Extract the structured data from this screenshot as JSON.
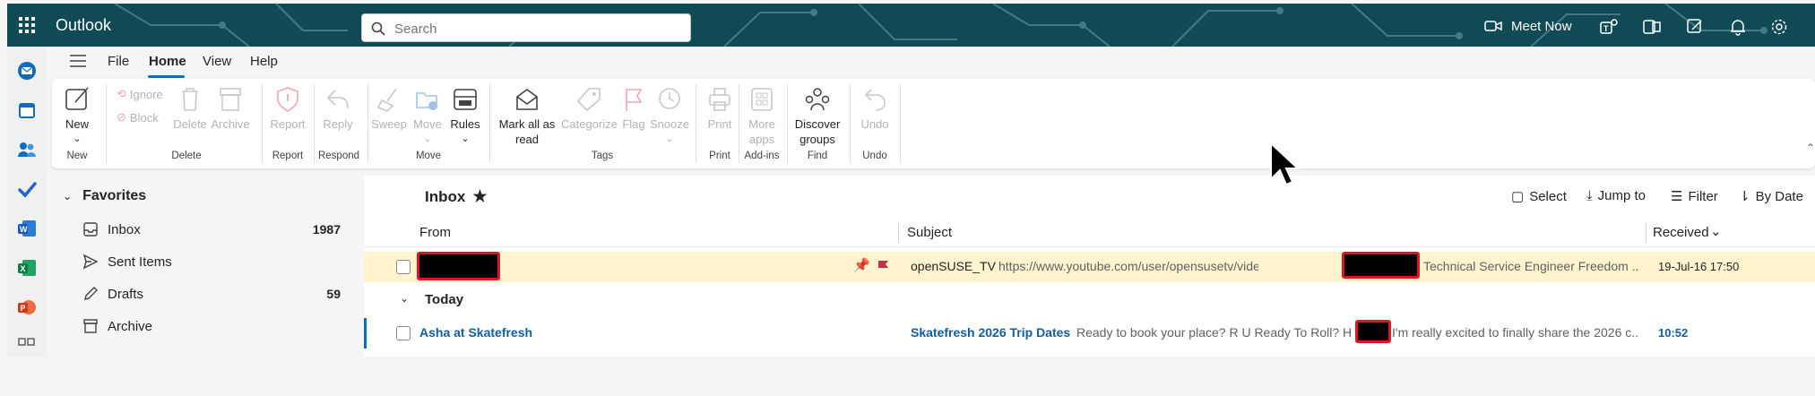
{
  "colors": {
    "brand": "#0f6cbd",
    "header_bg": "#0f4a55",
    "flag": "#c4314b",
    "highlight_row": "#fff4ce",
    "redaction_border": "#e81123"
  },
  "header": {
    "app_name": "Outlook",
    "search_placeholder": "Search",
    "meet_now_label": "Meet Now",
    "icons": [
      "waffle-icon",
      "search-icon",
      "video-icon",
      "teams-icon",
      "onenote-icon",
      "my-day-icon",
      "bell-icon",
      "gear-icon"
    ]
  },
  "app_rail": {
    "icons": [
      "mail-icon",
      "calendar-icon",
      "people-icon",
      "todo-icon",
      "word-icon",
      "excel-icon",
      "powerpoint-icon",
      "apps-icon"
    ]
  },
  "menu": {
    "tabs": [
      "File",
      "Home",
      "View",
      "Help"
    ],
    "active_tab": "Home"
  },
  "ribbon": {
    "new": {
      "label": "New",
      "group": "New"
    },
    "delete_group": {
      "ignore": "Ignore",
      "block": "Block",
      "delete": "Delete",
      "archive": "Archive",
      "group": "Delete"
    },
    "report": {
      "label": "Report",
      "group": "Report"
    },
    "respond": {
      "label": "Reply",
      "group": "Respond"
    },
    "move_group": {
      "sweep": "Sweep",
      "move": "Move",
      "rules": "Rules",
      "group": "Move"
    },
    "tags_group": {
      "mark_all_read": "Mark all as read",
      "categorize": "Categorize",
      "flag": "Flag",
      "snooze": "Snooze",
      "group": "Tags"
    },
    "print": {
      "label": "Print",
      "group": "Print"
    },
    "addins": {
      "label": "More apps",
      "group": "Add-ins"
    },
    "find": {
      "label": "Discover groups",
      "group": "Find"
    },
    "undo": {
      "label": "Undo",
      "group": "Undo"
    }
  },
  "folders": {
    "favorites_label": "Favorites",
    "items": [
      {
        "name": "Inbox",
        "count": "1987",
        "icon": "inbox-icon"
      },
      {
        "name": "Sent Items",
        "count": "",
        "icon": "send-icon"
      },
      {
        "name": "Drafts",
        "count": "59",
        "icon": "pencil-icon"
      },
      {
        "name": "Archive",
        "count": "",
        "icon": "archive-icon"
      }
    ]
  },
  "message_list": {
    "title": "Inbox",
    "actions": {
      "select": "Select",
      "jump_to": "Jump to",
      "filter": "Filter",
      "sort": "By Date"
    },
    "columns": {
      "from": "From",
      "subject": "Subject",
      "received": "Received"
    },
    "pinned": {
      "from": "",
      "subject": "openSUSE_TV",
      "preview_a": "https://www.youtube.com/user/opensusetv/videos Thank you",
      "preview_b": "Technical Service Engineer Freedom ...",
      "received": "19-Jul-16 17:50"
    },
    "today_label": "Today",
    "messages": [
      {
        "from": "Asha at Skatefresh",
        "subject": "Skatefresh 2026 Trip Dates",
        "preview_a": "Ready to book your place? R U Ready To Roll? Hi",
        "preview_b": "I'm really excited to finally share the 2026 c...",
        "received": "10:52"
      }
    ]
  }
}
